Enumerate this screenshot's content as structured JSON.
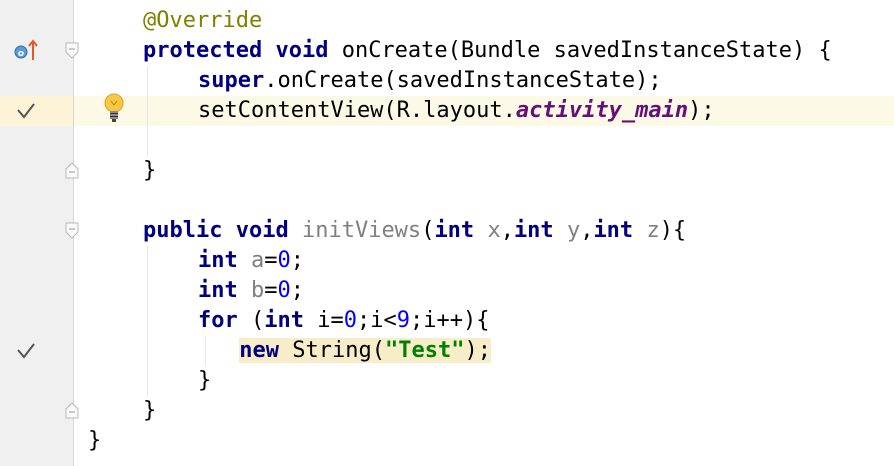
{
  "editor": {
    "lines": [
      {
        "indent": 2,
        "tokens": [
          {
            "t": "@Override",
            "c": "ann"
          }
        ]
      },
      {
        "indent": 2,
        "tokens": [
          {
            "t": "protected",
            "c": "kw"
          },
          {
            "t": " "
          },
          {
            "t": "void",
            "c": "kw"
          },
          {
            "t": " onCreate(Bundle savedInstanceState) {"
          }
        ]
      },
      {
        "indent": 4,
        "tokens": [
          {
            "t": "super",
            "c": "kw"
          },
          {
            "t": ".onCreate(savedInstanceState);"
          }
        ]
      },
      {
        "indent": 4,
        "tokens": [
          {
            "t": "setContentView(R.layout."
          },
          {
            "t": "activity_main",
            "c": "fld"
          },
          {
            "t": ");"
          }
        ]
      },
      {
        "indent": 0,
        "tokens": []
      },
      {
        "indent": 2,
        "tokens": [
          {
            "t": "}"
          }
        ]
      },
      {
        "indent": 0,
        "tokens": []
      },
      {
        "indent": 2,
        "tokens": [
          {
            "t": "public",
            "c": "kw"
          },
          {
            "t": " "
          },
          {
            "t": "void",
            "c": "kw"
          },
          {
            "t": " "
          },
          {
            "t": "initViews",
            "c": "unused"
          },
          {
            "t": "("
          },
          {
            "t": "int",
            "c": "kw"
          },
          {
            "t": " "
          },
          {
            "t": "x",
            "c": "unused"
          },
          {
            "t": ","
          },
          {
            "t": "int",
            "c": "kw"
          },
          {
            "t": " "
          },
          {
            "t": "y",
            "c": "unused"
          },
          {
            "t": ","
          },
          {
            "t": "int",
            "c": "kw"
          },
          {
            "t": " "
          },
          {
            "t": "z",
            "c": "unused"
          },
          {
            "t": "){"
          }
        ]
      },
      {
        "indent": 4,
        "tokens": [
          {
            "t": "int",
            "c": "kw"
          },
          {
            "t": " "
          },
          {
            "t": "a",
            "c": "unused"
          },
          {
            "t": "="
          },
          {
            "t": "0",
            "c": "num"
          },
          {
            "t": ";"
          }
        ]
      },
      {
        "indent": 4,
        "tokens": [
          {
            "t": "int",
            "c": "kw"
          },
          {
            "t": " "
          },
          {
            "t": "b",
            "c": "unused"
          },
          {
            "t": "="
          },
          {
            "t": "0",
            "c": "num"
          },
          {
            "t": ";"
          }
        ]
      },
      {
        "indent": 4,
        "tokens": [
          {
            "t": "for",
            "c": "kw"
          },
          {
            "t": " ("
          },
          {
            "t": "int",
            "c": "kw"
          },
          {
            "t": " i="
          },
          {
            "t": "0",
            "c": "num"
          },
          {
            "t": ";i<"
          },
          {
            "t": "9",
            "c": "num"
          },
          {
            "t": ";i++){"
          }
        ]
      },
      {
        "indent": 5.5,
        "hl": true,
        "tokens": [
          {
            "t": "new",
            "c": "kw"
          },
          {
            "t": " String("
          },
          {
            "t": "\"Test\"",
            "c": "str"
          },
          {
            "t": ");"
          }
        ]
      },
      {
        "indent": 4,
        "tokens": [
          {
            "t": "}"
          }
        ]
      },
      {
        "indent": 2,
        "tokens": [
          {
            "t": "}"
          }
        ]
      },
      {
        "indent": 0,
        "tokens": [
          {
            "t": "}"
          }
        ]
      }
    ]
  },
  "gutter": {
    "checks": [
      3,
      11
    ],
    "fold_open": [
      1,
      7
    ],
    "fold_close": [
      5,
      13
    ],
    "override_line": 1,
    "bulb_line": 3
  },
  "colors": {
    "keyword": "#000080",
    "annotation": "#808000",
    "field": "#660e7a",
    "number": "#0000ff",
    "string": "#008000",
    "unused": "#808080",
    "current_line": "#fdf9e7"
  }
}
